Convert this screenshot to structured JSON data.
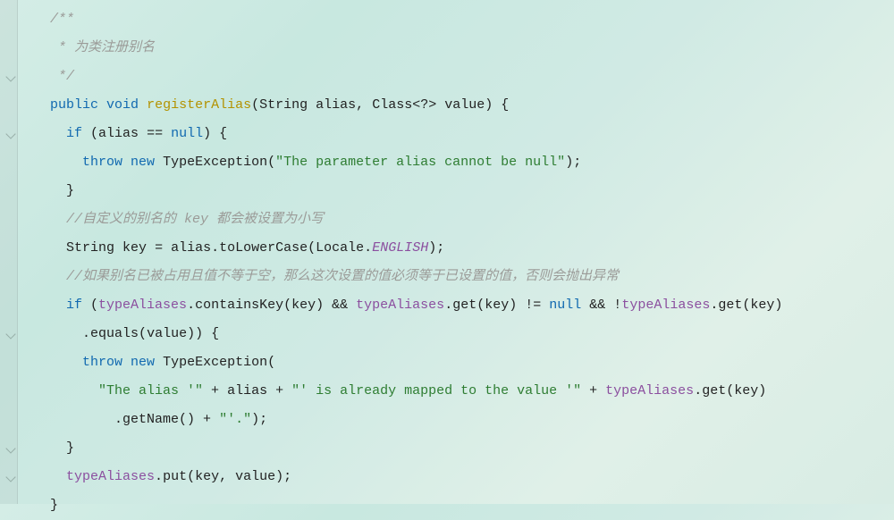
{
  "code": {
    "lines": [
      {
        "indent": 1,
        "tokens": [
          {
            "cls": "comment",
            "text": "/**"
          }
        ]
      },
      {
        "indent": 1,
        "tokens": [
          {
            "cls": "comment",
            "text": " * 为类注册别名"
          }
        ]
      },
      {
        "indent": 1,
        "tokens": [
          {
            "cls": "comment",
            "text": " */"
          }
        ]
      },
      {
        "indent": 1,
        "tokens": [
          {
            "cls": "keyword",
            "text": "public"
          },
          {
            "cls": "punct",
            "text": " "
          },
          {
            "cls": "keyword",
            "text": "void"
          },
          {
            "cls": "punct",
            "text": " "
          },
          {
            "cls": "method-decl",
            "text": "registerAlias"
          },
          {
            "cls": "punct",
            "text": "("
          },
          {
            "cls": "type",
            "text": "String"
          },
          {
            "cls": "punct",
            "text": " "
          },
          {
            "cls": "ident",
            "text": "alias"
          },
          {
            "cls": "punct",
            "text": ", "
          },
          {
            "cls": "type",
            "text": "Class"
          },
          {
            "cls": "punct",
            "text": "<?> "
          },
          {
            "cls": "ident",
            "text": "value"
          },
          {
            "cls": "punct",
            "text": ") {"
          }
        ]
      },
      {
        "indent": 2,
        "tokens": [
          {
            "cls": "keyword",
            "text": "if"
          },
          {
            "cls": "punct",
            "text": " ("
          },
          {
            "cls": "ident",
            "text": "alias"
          },
          {
            "cls": "punct",
            "text": " == "
          },
          {
            "cls": "keyword",
            "text": "null"
          },
          {
            "cls": "punct",
            "text": ") {"
          }
        ]
      },
      {
        "indent": 3,
        "tokens": [
          {
            "cls": "keyword",
            "text": "throw"
          },
          {
            "cls": "punct",
            "text": " "
          },
          {
            "cls": "keyword",
            "text": "new"
          },
          {
            "cls": "punct",
            "text": " "
          },
          {
            "cls": "type",
            "text": "TypeException"
          },
          {
            "cls": "punct",
            "text": "("
          },
          {
            "cls": "string",
            "text": "\"The parameter alias cannot be null\""
          },
          {
            "cls": "punct",
            "text": ");"
          }
        ]
      },
      {
        "indent": 2,
        "tokens": [
          {
            "cls": "punct",
            "text": "}"
          }
        ]
      },
      {
        "indent": 2,
        "tokens": [
          {
            "cls": "comment",
            "text": "//自定义的别名的 key 都会被设置为小写"
          }
        ]
      },
      {
        "indent": 2,
        "tokens": [
          {
            "cls": "type",
            "text": "String"
          },
          {
            "cls": "punct",
            "text": " "
          },
          {
            "cls": "ident",
            "text": "key"
          },
          {
            "cls": "punct",
            "text": " = "
          },
          {
            "cls": "ident",
            "text": "alias"
          },
          {
            "cls": "punct",
            "text": "."
          },
          {
            "cls": "method-call",
            "text": "toLowerCase"
          },
          {
            "cls": "punct",
            "text": "("
          },
          {
            "cls": "type",
            "text": "Locale"
          },
          {
            "cls": "punct",
            "text": "."
          },
          {
            "cls": "static-field",
            "text": "ENGLISH"
          },
          {
            "cls": "punct",
            "text": ");"
          }
        ]
      },
      {
        "indent": 2,
        "tokens": [
          {
            "cls": "comment",
            "text": "//如果别名已被占用且值不等于空，那么这次设置的值必须等于已设置的值，否则会抛出异常"
          }
        ]
      },
      {
        "indent": 2,
        "tokens": [
          {
            "cls": "keyword",
            "text": "if"
          },
          {
            "cls": "punct",
            "text": " ("
          },
          {
            "cls": "field",
            "text": "typeAliases"
          },
          {
            "cls": "punct",
            "text": "."
          },
          {
            "cls": "method-call",
            "text": "containsKey"
          },
          {
            "cls": "punct",
            "text": "("
          },
          {
            "cls": "ident",
            "text": "key"
          },
          {
            "cls": "punct",
            "text": ") && "
          },
          {
            "cls": "field",
            "text": "typeAliases"
          },
          {
            "cls": "punct",
            "text": "."
          },
          {
            "cls": "method-call",
            "text": "get"
          },
          {
            "cls": "punct",
            "text": "("
          },
          {
            "cls": "ident",
            "text": "key"
          },
          {
            "cls": "punct",
            "text": ") != "
          },
          {
            "cls": "keyword",
            "text": "null"
          },
          {
            "cls": "punct",
            "text": " && !"
          },
          {
            "cls": "field",
            "text": "typeAliases"
          },
          {
            "cls": "punct",
            "text": "."
          },
          {
            "cls": "method-call",
            "text": "get"
          },
          {
            "cls": "punct",
            "text": "("
          },
          {
            "cls": "ident",
            "text": "key"
          },
          {
            "cls": "punct",
            "text": ")"
          }
        ]
      },
      {
        "indent": 3,
        "tokens": [
          {
            "cls": "punct",
            "text": "."
          },
          {
            "cls": "method-call",
            "text": "equals"
          },
          {
            "cls": "punct",
            "text": "("
          },
          {
            "cls": "ident",
            "text": "value"
          },
          {
            "cls": "punct",
            "text": ")) {"
          }
        ]
      },
      {
        "indent": 3,
        "tokens": [
          {
            "cls": "keyword",
            "text": "throw"
          },
          {
            "cls": "punct",
            "text": " "
          },
          {
            "cls": "keyword",
            "text": "new"
          },
          {
            "cls": "punct",
            "text": " "
          },
          {
            "cls": "type",
            "text": "TypeException"
          },
          {
            "cls": "punct",
            "text": "("
          }
        ]
      },
      {
        "indent": 4,
        "tokens": [
          {
            "cls": "string",
            "text": "\"The alias '\""
          },
          {
            "cls": "punct",
            "text": " + "
          },
          {
            "cls": "ident",
            "text": "alias"
          },
          {
            "cls": "punct",
            "text": " + "
          },
          {
            "cls": "string",
            "text": "\"' is already mapped to the value '\""
          },
          {
            "cls": "punct",
            "text": " + "
          },
          {
            "cls": "field",
            "text": "typeAliases"
          },
          {
            "cls": "punct",
            "text": "."
          },
          {
            "cls": "method-call",
            "text": "get"
          },
          {
            "cls": "punct",
            "text": "("
          },
          {
            "cls": "ident",
            "text": "key"
          },
          {
            "cls": "punct",
            "text": ")"
          }
        ]
      },
      {
        "indent": 5,
        "tokens": [
          {
            "cls": "punct",
            "text": "."
          },
          {
            "cls": "method-call",
            "text": "getName"
          },
          {
            "cls": "punct",
            "text": "() + "
          },
          {
            "cls": "string",
            "text": "\"'.\""
          },
          {
            "cls": "punct",
            "text": ");"
          }
        ]
      },
      {
        "indent": 2,
        "tokens": [
          {
            "cls": "punct",
            "text": "}"
          }
        ]
      },
      {
        "indent": 2,
        "tokens": [
          {
            "cls": "field",
            "text": "typeAliases"
          },
          {
            "cls": "punct",
            "text": "."
          },
          {
            "cls": "method-call",
            "text": "put"
          },
          {
            "cls": "punct",
            "text": "("
          },
          {
            "cls": "ident",
            "text": "key"
          },
          {
            "cls": "punct",
            "text": ", "
          },
          {
            "cls": "ident",
            "text": "value"
          },
          {
            "cls": "punct",
            "text": ");"
          }
        ]
      },
      {
        "indent": 1,
        "tokens": [
          {
            "cls": "punct",
            "text": "}"
          }
        ]
      }
    ]
  },
  "gutter": {
    "fold_markers_at_lines": [
      2,
      4,
      11,
      15,
      16
    ]
  }
}
